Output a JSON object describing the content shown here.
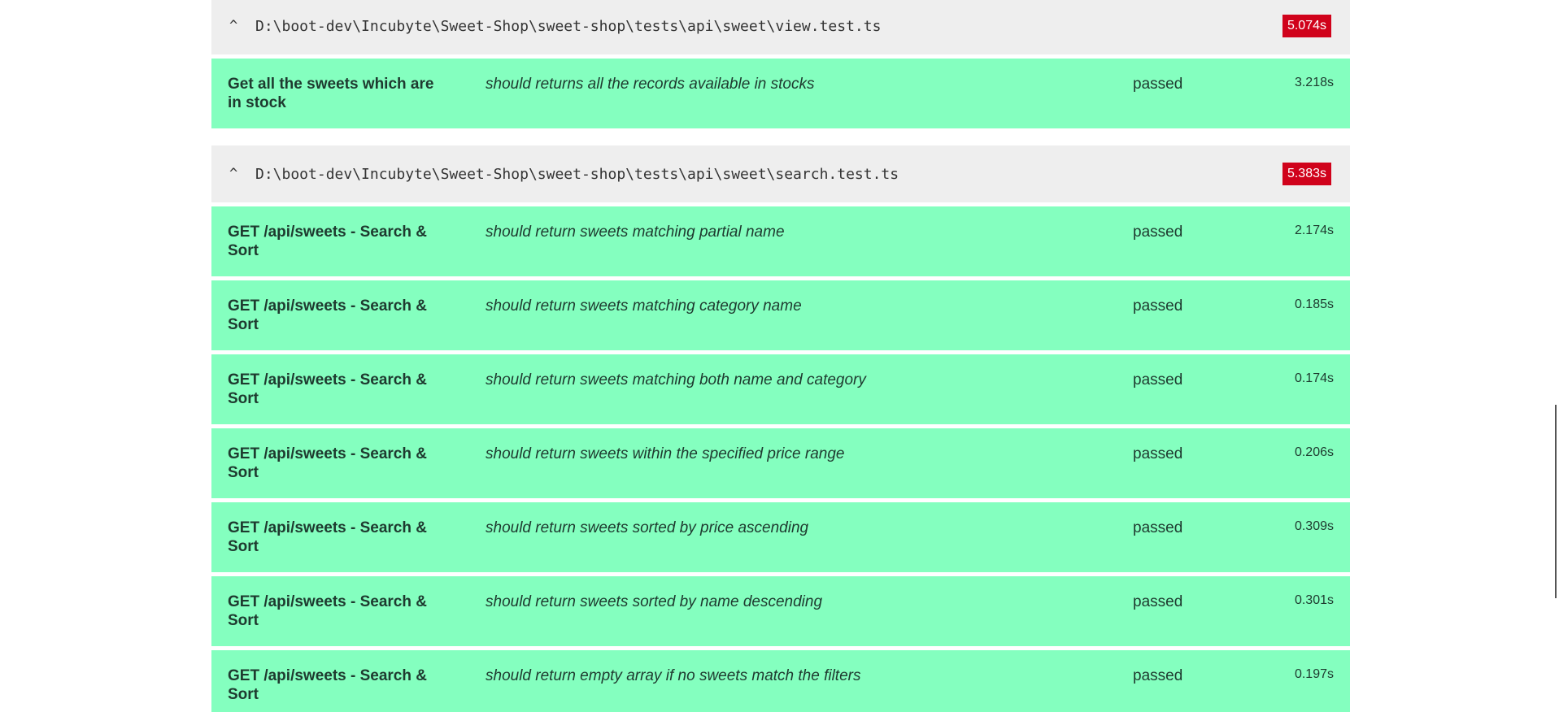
{
  "suites": [
    {
      "toggle": "^",
      "path": "D:\\boot-dev\\Incubyte\\Sweet-Shop\\sweet-shop\\tests\\api\\sweet\\view.test.ts",
      "duration": "5.074s",
      "tests": [
        {
          "suite_name": "Get all the sweets which are in stock",
          "title": "should returns all the records available in stocks",
          "status": "passed",
          "duration": "3.218s"
        }
      ]
    },
    {
      "toggle": "^",
      "path": "D:\\boot-dev\\Incubyte\\Sweet-Shop\\sweet-shop\\tests\\api\\sweet\\search.test.ts",
      "duration": "5.383s",
      "tests": [
        {
          "suite_name": "GET /api/sweets - Search & Sort",
          "title": "should return sweets matching partial name",
          "status": "passed",
          "duration": "2.174s"
        },
        {
          "suite_name": "GET /api/sweets - Search & Sort",
          "title": "should return sweets matching category name",
          "status": "passed",
          "duration": "0.185s"
        },
        {
          "suite_name": "GET /api/sweets - Search & Sort",
          "title": "should return sweets matching both name and category",
          "status": "passed",
          "duration": "0.174s"
        },
        {
          "suite_name": "GET /api/sweets - Search & Sort",
          "title": "should return sweets within the specified price range",
          "status": "passed",
          "duration": "0.206s"
        },
        {
          "suite_name": "GET /api/sweets - Search & Sort",
          "title": "should return sweets sorted by price ascending",
          "status": "passed",
          "duration": "0.309s"
        },
        {
          "suite_name": "GET /api/sweets - Search & Sort",
          "title": "should return sweets sorted by name descending",
          "status": "passed",
          "duration": "0.301s"
        },
        {
          "suite_name": "GET /api/sweets - Search & Sort",
          "title": "should return empty array if no sweets match the filters",
          "status": "passed",
          "duration": "0.197s"
        }
      ]
    }
  ],
  "colors": {
    "passed_row": "#84ffbf",
    "suite_header": "#eeeeee",
    "duration_badge": "#d0021b"
  }
}
